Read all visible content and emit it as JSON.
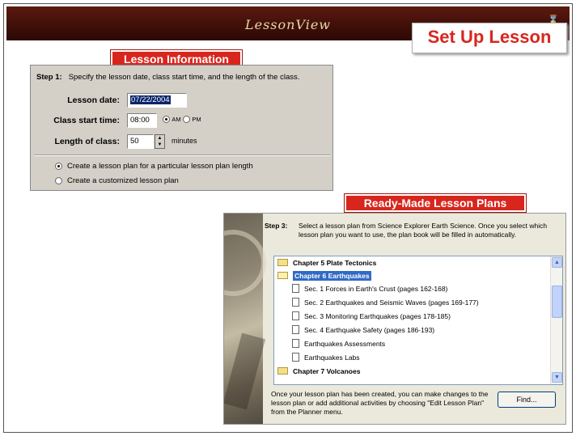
{
  "app": {
    "title": "LessonView",
    "busy_icon": "hourglass-icon"
  },
  "badges": {
    "setup": "Set Up Lesson",
    "info": "Lesson Information",
    "ready": "Ready-Made Lesson Plans"
  },
  "step1": {
    "label": "Step 1:",
    "text": "Specify the lesson date, class start time, and the length of the class.",
    "lesson_date_label": "Lesson date:",
    "lesson_date_value": "07/22/2004",
    "start_time_label": "Class start time:",
    "start_time_value": "08:00",
    "am_label": "AM",
    "pm_label": "PM",
    "ampm_selected": "AM",
    "length_label": "Length of class:",
    "length_value": "50",
    "length_unit": "minutes",
    "options": [
      {
        "label": "Create a lesson plan for a particular lesson plan length",
        "selected": true
      },
      {
        "label": "Create a customized lesson plan",
        "selected": false
      }
    ]
  },
  "step3": {
    "label": "Step 3:",
    "text": "Select a lesson plan from Science Explorer Earth Science.  Once you select which lesson plan you want to use, the plan book will be filled in automatically.",
    "tree": [
      {
        "type": "chapter",
        "label": "Chapter 5 Plate Tectonics"
      },
      {
        "type": "chapter",
        "label": "Chapter 6 Earthquakes",
        "selected": true,
        "open": true
      },
      {
        "type": "item",
        "label": "Sec. 1  Forces in Earth's Crust (pages 162-168)"
      },
      {
        "type": "item",
        "label": "Sec. 2  Earthquakes and Seismic Waves (pages 169-177)"
      },
      {
        "type": "item",
        "label": "Sec. 3  Monitoring Earthquakes (pages 178-185)"
      },
      {
        "type": "item",
        "label": "Sec. 4  Earthquake Safety (pages 186-193)"
      },
      {
        "type": "item",
        "label": "Earthquakes Assessments"
      },
      {
        "type": "item",
        "label": "Earthquakes Labs"
      },
      {
        "type": "chapter",
        "label": "Chapter 7 Volcanoes"
      }
    ],
    "note": "Once your lesson plan has been created, you can make changes to the lesson plan or add additional activities by choosing \"Edit Lesson Plan\" from the Planner menu.",
    "find_button": "Find..."
  }
}
